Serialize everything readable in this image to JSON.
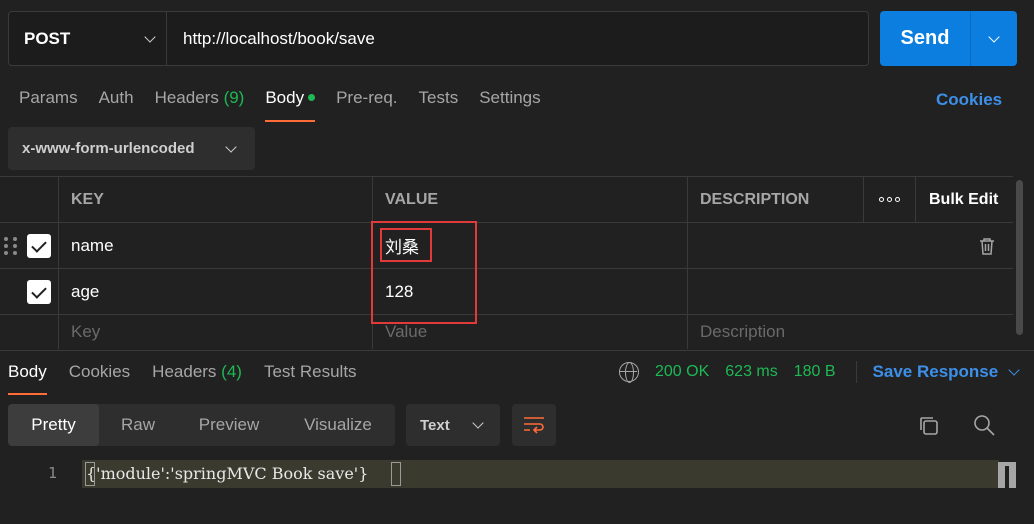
{
  "request": {
    "method": "POST",
    "url": "http://localhost/book/save",
    "send_label": "Send"
  },
  "request_tabs": [
    {
      "label": "Params"
    },
    {
      "label": "Auth"
    },
    {
      "label": "Headers",
      "count": "(9)"
    },
    {
      "label": "Body"
    },
    {
      "label": "Pre-req."
    },
    {
      "label": "Tests"
    },
    {
      "label": "Settings"
    }
  ],
  "cookies_label": "Cookies",
  "body_type": "x-www-form-urlencoded",
  "table": {
    "headers": {
      "key": "KEY",
      "value": "VALUE",
      "description": "DESCRIPTION",
      "bulk_edit": "Bulk Edit"
    },
    "rows": [
      {
        "key": "name",
        "value": "刘桑",
        "checked": true
      },
      {
        "key": "age",
        "value": "128",
        "checked": true
      }
    ],
    "placeholders": {
      "key": "Key",
      "value": "Value",
      "description": "Description"
    }
  },
  "response_tabs": [
    {
      "label": "Body"
    },
    {
      "label": "Cookies"
    },
    {
      "label": "Headers",
      "count": "(4)"
    },
    {
      "label": "Test Results"
    }
  ],
  "response_status": {
    "status": "200 OK",
    "time": "623 ms",
    "size": "180 B"
  },
  "save_response_label": "Save Response",
  "view_modes": [
    "Pretty",
    "Raw",
    "Preview",
    "Visualize"
  ],
  "format": "Text",
  "code": {
    "line_number": "1",
    "text": "{'module':'springMVC Book save'}"
  },
  "colors": {
    "accent": "#ff6c37",
    "send": "#0b7ee0",
    "status_green": "#1db954",
    "link_blue": "#3d8fe8",
    "highlight_red": "#e03a3a"
  }
}
